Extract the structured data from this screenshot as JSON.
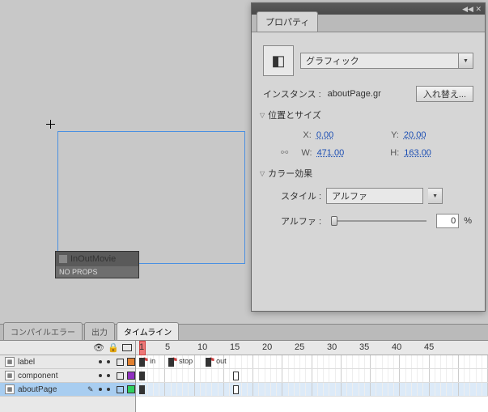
{
  "panel": {
    "tab": "プロパティ",
    "type_label": "グラフィック",
    "instance_label": "インスタンス :",
    "instance_name": "aboutPage.gr",
    "swap_button": "入れ替え...",
    "section_pos": "位置とサイズ",
    "pos": {
      "x_label": "X:",
      "x": "0.00",
      "y_label": "Y:",
      "y": "20.00",
      "w_label": "W:",
      "w": "471.00",
      "h_label": "H:",
      "h": "163.00"
    },
    "section_color": "カラー効果",
    "style_label": "スタイル :",
    "style_value": "アルファ",
    "alpha_label": "アルファ :",
    "alpha_value": "0",
    "alpha_unit": "%"
  },
  "stage_instance": {
    "name": "InOutMovie",
    "sub": "NO PROPS"
  },
  "bottom_tabs": {
    "compile": "コンパイルエラー",
    "output": "出力",
    "timeline": "タイムライン"
  },
  "layers": [
    {
      "name": "label",
      "color": "#e08030",
      "selected": false
    },
    {
      "name": "component",
      "color": "#9030c0",
      "selected": false
    },
    {
      "name": "aboutPage",
      "color": "#30d060",
      "selected": true
    }
  ],
  "ruler_marks": [
    "1",
    "5",
    "10",
    "15",
    "20",
    "25",
    "30",
    "35",
    "40",
    "45"
  ],
  "frame_labels": {
    "in": "in",
    "stop": "stop",
    "out": "out"
  }
}
